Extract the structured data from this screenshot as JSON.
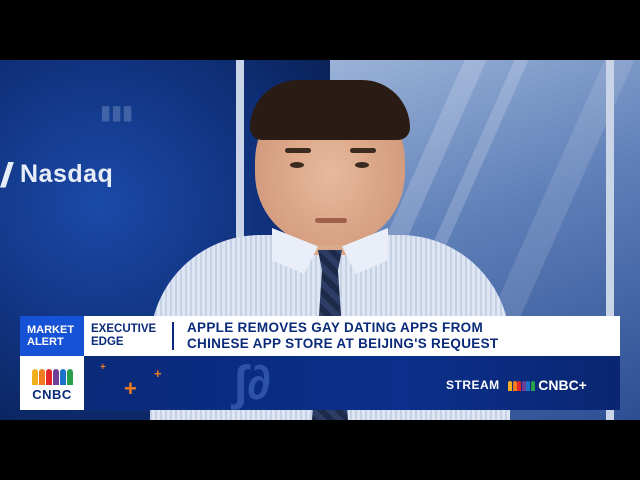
{
  "scene": {
    "wall_text": "Nasdaq"
  },
  "lower_third": {
    "alert_line1": "MARKET",
    "alert_line2": "ALERT",
    "show_line1": "EXECUTIVE",
    "show_line2": "EDGE",
    "headline_line1": "APPLE REMOVES GAY DATING APPS FROM",
    "headline_line2": "CHINESE APP STORE AT BEIJING'S REQUEST",
    "logo_text": "CNBC",
    "stream_label": "STREAM",
    "stream_brand": "CNBC+"
  },
  "colors": {
    "network_blue": "#0a2a7a",
    "alert_blue": "#1652d6",
    "accent_orange": "#f07c1f"
  },
  "peacock_colors": [
    "#f2b01e",
    "#f07c1f",
    "#e2262b",
    "#6f3f97",
    "#1a73c9",
    "#2aa04a"
  ]
}
